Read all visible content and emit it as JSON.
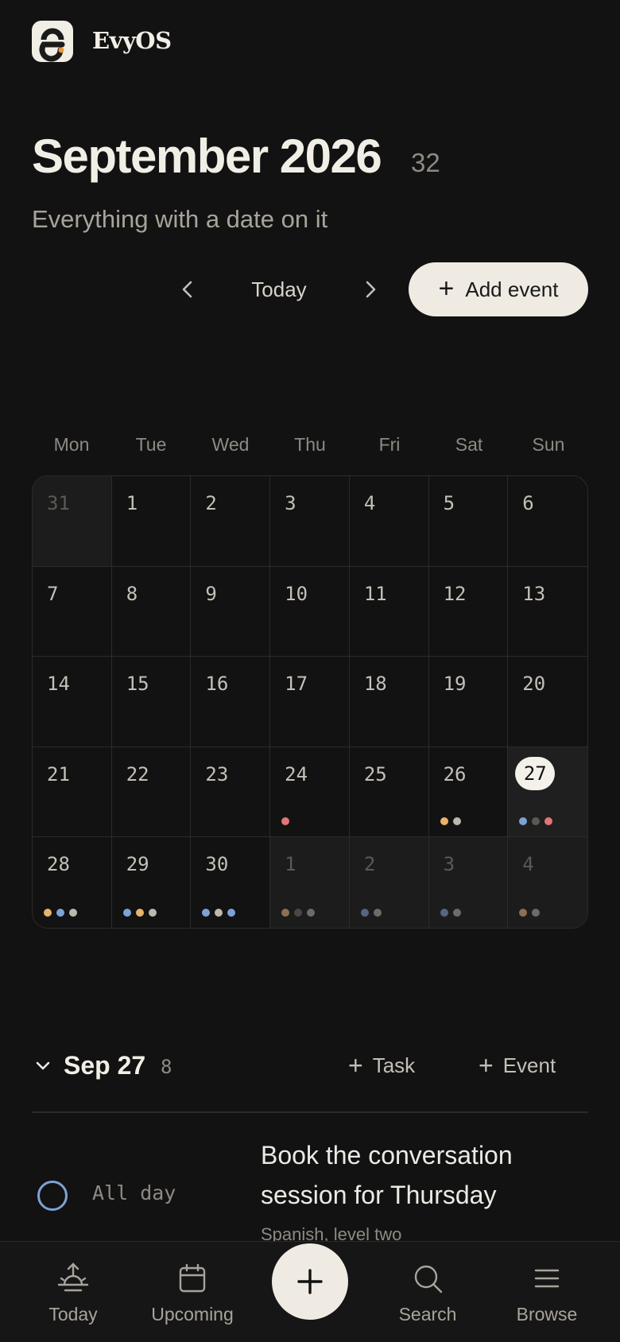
{
  "app": {
    "name": "EvyOS",
    "logo_icon": "evy-logo-icon"
  },
  "header": {
    "title": "September 2026",
    "count": "32",
    "subtitle": "Everything with a date on it"
  },
  "toolbar": {
    "prev_icon": "chevron-left-icon",
    "today_label": "Today",
    "next_icon": "chevron-right-icon",
    "add_event_label": "Add event"
  },
  "calendar": {
    "weekdays": [
      "Mon",
      "Tue",
      "Wed",
      "Thu",
      "Fri",
      "Sat",
      "Sun"
    ],
    "days": [
      {
        "n": "31",
        "muted": true,
        "dots": []
      },
      {
        "n": "1",
        "dots": []
      },
      {
        "n": "2",
        "dots": []
      },
      {
        "n": "3",
        "dots": []
      },
      {
        "n": "4",
        "dots": []
      },
      {
        "n": "5",
        "dots": []
      },
      {
        "n": "6",
        "dots": []
      },
      {
        "n": "7",
        "dots": []
      },
      {
        "n": "8",
        "dots": []
      },
      {
        "n": "9",
        "dots": []
      },
      {
        "n": "10",
        "dots": []
      },
      {
        "n": "11",
        "dots": []
      },
      {
        "n": "12",
        "dots": []
      },
      {
        "n": "13",
        "dots": []
      },
      {
        "n": "14",
        "dots": []
      },
      {
        "n": "15",
        "dots": []
      },
      {
        "n": "16",
        "dots": []
      },
      {
        "n": "17",
        "dots": []
      },
      {
        "n": "18",
        "dots": []
      },
      {
        "n": "19",
        "dots": []
      },
      {
        "n": "20",
        "dots": []
      },
      {
        "n": "21",
        "dots": []
      },
      {
        "n": "22",
        "dots": []
      },
      {
        "n": "23",
        "dots": []
      },
      {
        "n": "24",
        "dots": [
          "#E07676"
        ]
      },
      {
        "n": "25",
        "dots": []
      },
      {
        "n": "26",
        "dots": [
          "#E8B36A",
          "#BDB8AE"
        ]
      },
      {
        "n": "27",
        "selected": true,
        "dots": [
          "#7CA3D6",
          "#5C5955",
          "#E07676"
        ]
      },
      {
        "n": "28",
        "dots": [
          "#E8B36A",
          "#7CA3D6",
          "#BDB8AE"
        ]
      },
      {
        "n": "29",
        "dots": [
          "#7CA3D6",
          "#E8B36A",
          "#BDB8AE"
        ]
      },
      {
        "n": "30",
        "dots": [
          "#7CA3D6",
          "#BDB8AE",
          "#7CA3D6"
        ]
      },
      {
        "n": "1",
        "muted": true,
        "dots": [
          "#8A7250",
          "#4A4845",
          "#6E6B66"
        ]
      },
      {
        "n": "2",
        "muted": true,
        "dots": [
          "#55667E",
          "#6E6B66"
        ]
      },
      {
        "n": "3",
        "muted": true,
        "dots": [
          "#55667E",
          "#6E6B66"
        ]
      },
      {
        "n": "4",
        "muted": true,
        "dots": [
          "#8A7250",
          "#6E6B66"
        ]
      }
    ]
  },
  "day_section": {
    "collapse_icon": "chevron-down-icon",
    "label": "Sep 27",
    "count": "8",
    "task_label": "Task",
    "event_label": "Event"
  },
  "tasks": [
    {
      "time": "All day",
      "title": "Book the conversation session for Thursday",
      "subtitle": "Spanish, level two"
    }
  ],
  "bottom_nav": {
    "items": [
      {
        "label": "Today",
        "icon": "sunrise-icon"
      },
      {
        "label": "Upcoming",
        "icon": "calendar-icon"
      },
      {
        "label": "Search",
        "icon": "search-icon"
      },
      {
        "label": "Browse",
        "icon": "menu-icon"
      }
    ],
    "fab_icon": "plus-icon"
  },
  "colors": {
    "background": "#121212",
    "accent_light": "#EFEBE3",
    "blue": "#7CA3D6",
    "orange": "#E8B36A",
    "red": "#E07676",
    "gray": "#BDB8AE"
  }
}
